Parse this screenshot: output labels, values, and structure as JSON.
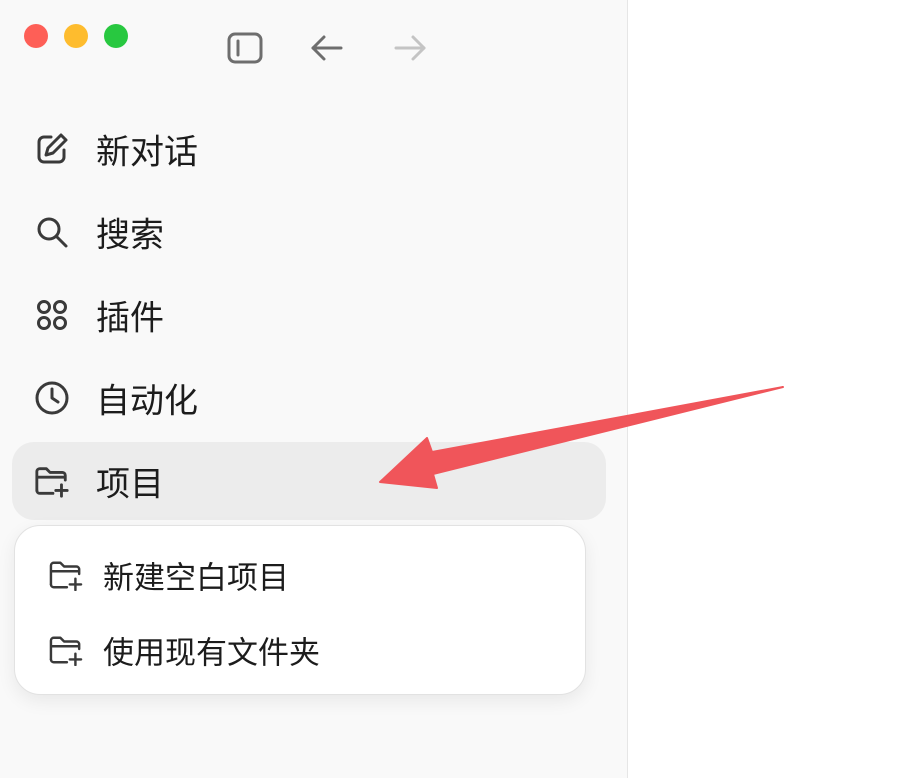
{
  "window": {
    "traffic_lights": {
      "close_color": "#fe5f57",
      "minimize_color": "#febc2e",
      "maximize_color": "#28c840"
    }
  },
  "toolbar": {
    "icons": [
      "sidebar-toggle-icon",
      "back-arrow-icon",
      "forward-arrow-icon"
    ]
  },
  "sidebar": {
    "items": [
      {
        "label": "新对话",
        "icon": "edit-icon"
      },
      {
        "label": "搜索",
        "icon": "search-icon"
      },
      {
        "label": "插件",
        "icon": "plugins-grid-icon"
      },
      {
        "label": "自动化",
        "icon": "clock-icon"
      },
      {
        "label": "项目",
        "icon": "folder-plus-icon",
        "active": true
      }
    ]
  },
  "project_menu": {
    "items": [
      {
        "label": "新建空白项目",
        "icon": "folder-plus-icon"
      },
      {
        "label": "使用现有文件夹",
        "icon": "folder-plus-icon"
      }
    ]
  },
  "annotation": {
    "arrow_color": "#f0555a"
  }
}
